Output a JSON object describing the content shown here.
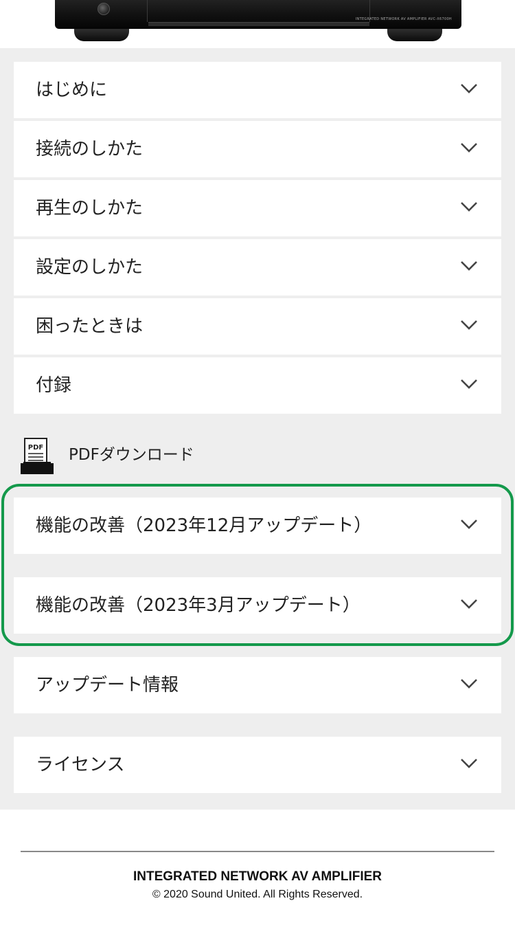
{
  "hero": {
    "device_image": "av-amplifier-front-panel",
    "device_panel_text": "INTEGRATED NETWORK AV AMPLIFIER   AVC-X6700H"
  },
  "menu": {
    "items": [
      {
        "label": "はじめに",
        "icon": "chevron-down-icon"
      },
      {
        "label": "接続のしかた",
        "icon": "chevron-down-icon"
      },
      {
        "label": "再生のしかた",
        "icon": "chevron-down-icon"
      },
      {
        "label": "設定のしかた",
        "icon": "chevron-down-icon"
      },
      {
        "label": "困ったときは",
        "icon": "chevron-down-icon"
      },
      {
        "label": "付録",
        "icon": "chevron-down-icon"
      }
    ]
  },
  "pdf": {
    "label": "PDFダウンロード",
    "icon": "pdf-icon",
    "icon_text": "PDF"
  },
  "updates": {
    "items": [
      {
        "label": "機能の改善（2023年12月アップデート）",
        "icon": "chevron-down-icon"
      },
      {
        "label": "機能の改善（2023年3月アップデート）",
        "icon": "chevron-down-icon"
      }
    ],
    "highlight_color": "#14994b"
  },
  "extra": {
    "items": [
      {
        "label": "アップデート情報",
        "icon": "chevron-down-icon"
      },
      {
        "label": "ライセンス",
        "icon": "chevron-down-icon"
      }
    ]
  },
  "footer": {
    "title": "INTEGRATED NETWORK AV AMPLIFIER",
    "copyright": "© 2020 Sound United. All Rights Reserved."
  },
  "colors": {
    "page_background": "#eeeeee",
    "card_background": "#ffffff",
    "chevron": "#444444",
    "text": "#222222"
  }
}
